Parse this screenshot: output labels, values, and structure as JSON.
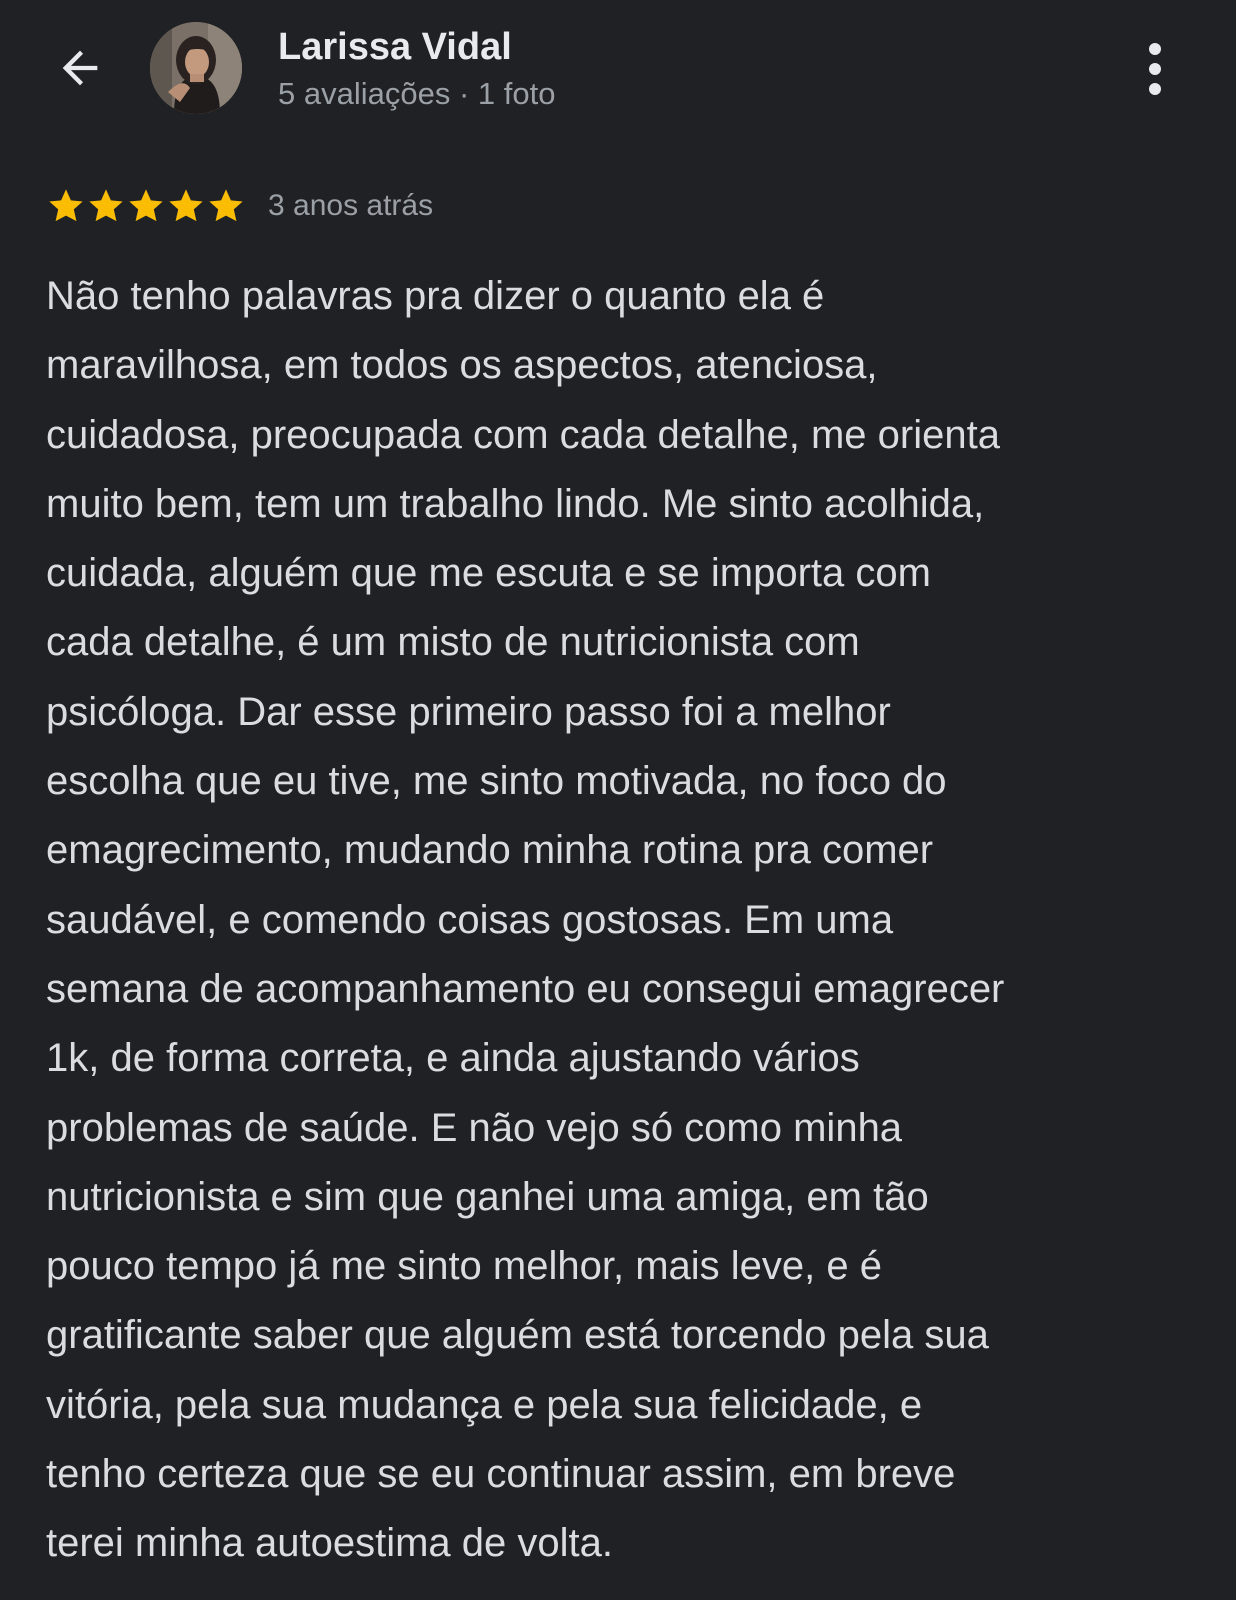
{
  "header": {
    "back_icon": "arrow-left-icon",
    "avatar_icon": "user-avatar-photo",
    "reviewer_name": "Larissa Vidal",
    "reviewer_meta": "5 avaliações · 1 foto",
    "more_icon": "more-vert-icon"
  },
  "review": {
    "rating": 5,
    "rating_max": 5,
    "star_color": "#fbbc04",
    "date": "3 anos atrás",
    "lines": [
      "Não tenho palavras pra dizer o quanto ela é",
      "maravilhosa, em todos os aspectos, atenciosa,",
      "cuidadosa, preocupada com cada detalhe, me orienta",
      "muito bem, tem um trabalho lindo. Me sinto acolhida,",
      "cuidada, alguém que me escuta e se importa com",
      "cada detalhe, é um misto de nutricionista com",
      "psicóloga. Dar esse primeiro passo foi a melhor",
      "escolha que eu tive, me sinto motivada, no foco do",
      "emagrecimento, mudando minha rotina pra comer",
      "saudável, e comendo coisas gostosas. Em uma",
      "semana de acompanhamento eu consegui emagrecer",
      "1k, de forma correta, e ainda ajustando vários",
      "problemas de saúde. E não vejo só como minha",
      "nutricionista e sim que ganhei uma amiga, em tão",
      "pouco tempo já me sinto melhor, mais leve, e é",
      "gratificante saber que alguém está torcendo pela sua",
      "vitória, pela sua mudança e pela sua felicidade, e",
      "tenho certeza que se eu continuar assim, em breve",
      "terei minha autoestima de volta."
    ]
  },
  "colors": {
    "background": "#202124",
    "primary_text": "#e8eaed",
    "secondary_text": "#9aa0a6"
  }
}
